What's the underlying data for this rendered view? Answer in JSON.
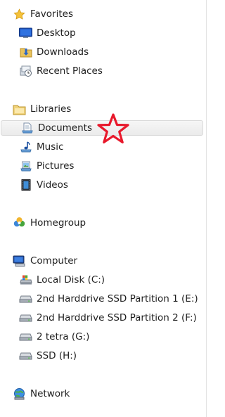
{
  "favorites": {
    "label": "Favorites",
    "icon": "star-icon",
    "items": [
      {
        "label": "Desktop",
        "icon": "desktop-icon"
      },
      {
        "label": "Downloads",
        "icon": "downloads-folder-icon"
      },
      {
        "label": "Recent Places",
        "icon": "recent-places-icon"
      }
    ]
  },
  "libraries": {
    "label": "Libraries",
    "icon": "libraries-folder-icon",
    "items": [
      {
        "label": "Documents",
        "icon": "documents-icon",
        "selected": true
      },
      {
        "label": "Music",
        "icon": "music-icon"
      },
      {
        "label": "Pictures",
        "icon": "pictures-icon"
      },
      {
        "label": "Videos",
        "icon": "videos-icon"
      }
    ]
  },
  "homegroup": {
    "label": "Homegroup",
    "icon": "homegroup-icon"
  },
  "computer": {
    "label": "Computer",
    "icon": "computer-icon",
    "items": [
      {
        "label": "Local Disk (C:)",
        "icon": "local-disk-icon"
      },
      {
        "label": "2nd Harddrive SSD Partition 1 (E:)",
        "icon": "drive-icon"
      },
      {
        "label": "2nd Harddrive SSD Partition 2 (F:)",
        "icon": "drive-icon"
      },
      {
        "label": "2 tetra (G:)",
        "icon": "drive-icon"
      },
      {
        "label": "SSD (H:)",
        "icon": "drive-icon"
      }
    ]
  },
  "network": {
    "label": "Network",
    "icon": "network-icon"
  },
  "annotation": {
    "icon": "red-star-outline-icon",
    "color": "#e8192c"
  }
}
